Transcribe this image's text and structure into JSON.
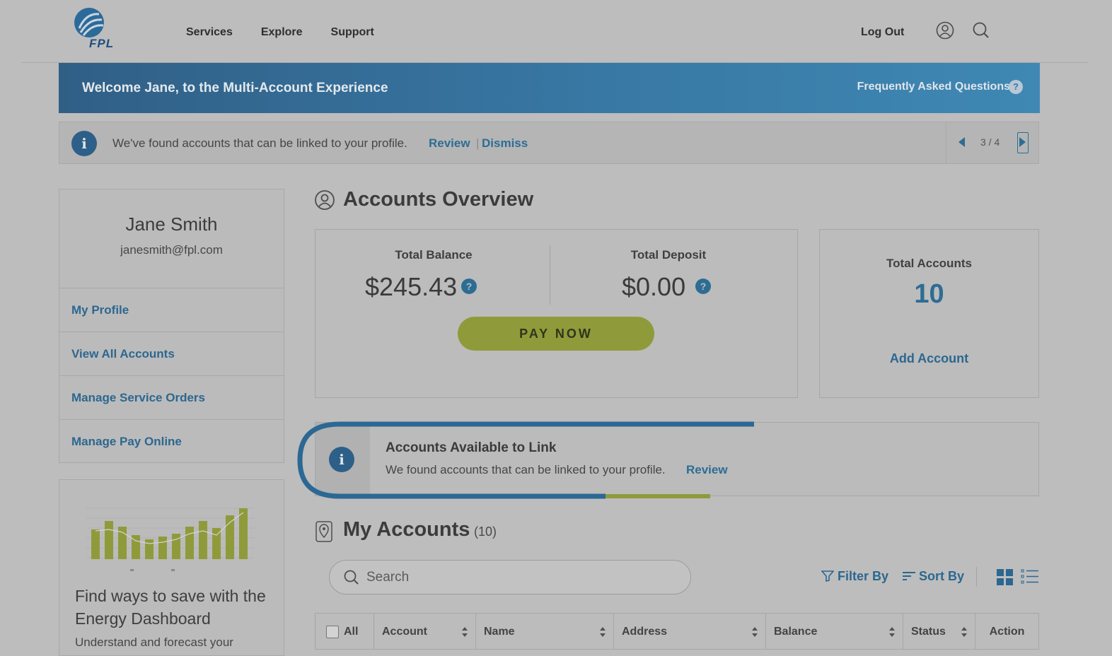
{
  "header": {
    "logo_text": "FPL",
    "nav": [
      "Services",
      "Explore",
      "Support"
    ],
    "logout": "Log Out",
    "icons": [
      "user-icon",
      "search-icon"
    ]
  },
  "welcome": {
    "title": "Welcome Jane, to the Multi-Account Experience",
    "faq": "Frequently Asked Questions",
    "faq_icon": "?"
  },
  "notice": {
    "icon": "i",
    "text": "We've found accounts that can be linked to your profile.",
    "review": "Review",
    "separator": "|",
    "dismiss": "Dismiss",
    "pager": "3 / 4"
  },
  "profile": {
    "name": "Jane Smith",
    "email": "janesmith@fpl.com",
    "links": [
      "My Profile",
      "View All Accounts",
      "Manage Service Orders",
      "Manage Pay Online"
    ]
  },
  "energy": {
    "title": "Find ways to save with the Energy Dashboard",
    "desc": "Understand and forecast your"
  },
  "overview": {
    "title": "Accounts Overview",
    "total_balance_label": "Total Balance",
    "total_balance": "$245.43",
    "total_deposit_label": "Total Deposit",
    "total_deposit": "$0.00",
    "help_icon": "?",
    "pay_now": "PAY NOW",
    "total_accounts_label": "Total Accounts",
    "total_accounts": "10",
    "add_account": "Add Account"
  },
  "link_banner": {
    "icon": "i",
    "title": "Accounts Available to Link",
    "text": "We found accounts that can be linked to your profile.",
    "review": "Review"
  },
  "my_accounts": {
    "title": "My Accounts",
    "count": "(10)",
    "search_placeholder": "Search",
    "filter": "Filter By",
    "sort": "Sort By",
    "columns": [
      "All",
      "Account",
      "Name",
      "Address",
      "Balance",
      "Status",
      "Action"
    ]
  },
  "colors": {
    "accent_blue": "#2d6d94",
    "banner_blue": "#3878a4",
    "pay_green": "#8f9b3a",
    "overlay_gray": "#bdbdbd"
  }
}
